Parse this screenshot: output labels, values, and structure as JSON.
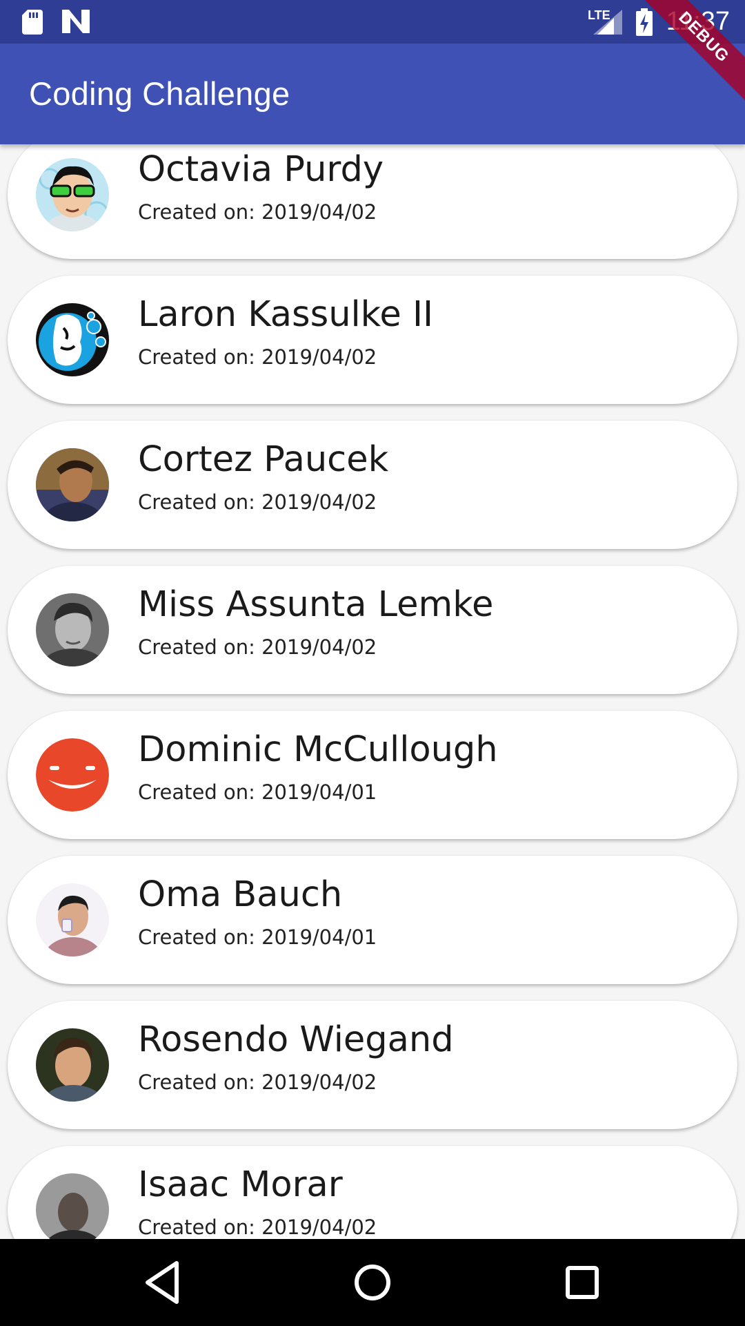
{
  "status_bar": {
    "time": "11:37",
    "network": "LTE",
    "left_icons": [
      "sd-card-icon",
      "n-logo-icon"
    ],
    "right_icons": [
      "lte-signal-icon",
      "battery-charging-icon"
    ]
  },
  "debug_banner": "DEBUG",
  "app_bar": {
    "title": "Coding Challenge"
  },
  "users": [
    {
      "name": "Octavia Purdy",
      "created": "Created on: 2019/04/02",
      "avatar": "cartoon-glasses-avatar"
    },
    {
      "name": "Laron Kassulke II",
      "created": "Created on: 2019/04/02",
      "avatar": "blue-face-avatar"
    },
    {
      "name": "Cortez Paucek",
      "created": "Created on: 2019/04/02",
      "avatar": "photo-avatar"
    },
    {
      "name": "Miss Assunta Lemke",
      "created": "Created on: 2019/04/02",
      "avatar": "photo-avatar"
    },
    {
      "name": "Dominic McCullough",
      "created": "Created on: 2019/04/01",
      "avatar": "smiley-avatar"
    },
    {
      "name": "Oma Bauch",
      "created": "Created on: 2019/04/01",
      "avatar": "photo-avatar"
    },
    {
      "name": "Rosendo Wiegand",
      "created": "Created on: 2019/04/02",
      "avatar": "photo-avatar"
    },
    {
      "name": "Isaac Morar",
      "created": "Created on: 2019/04/02",
      "avatar": "photo-avatar"
    }
  ],
  "nav_bar": {
    "buttons": [
      "back-icon",
      "home-icon",
      "recents-icon"
    ]
  },
  "colors": {
    "status_bar": "#2f3d94",
    "app_bar": "#3f51b5",
    "background": "#f5f5f5",
    "card": "#ffffff",
    "smiley": "#e8472a",
    "debug": "#a80026"
  }
}
